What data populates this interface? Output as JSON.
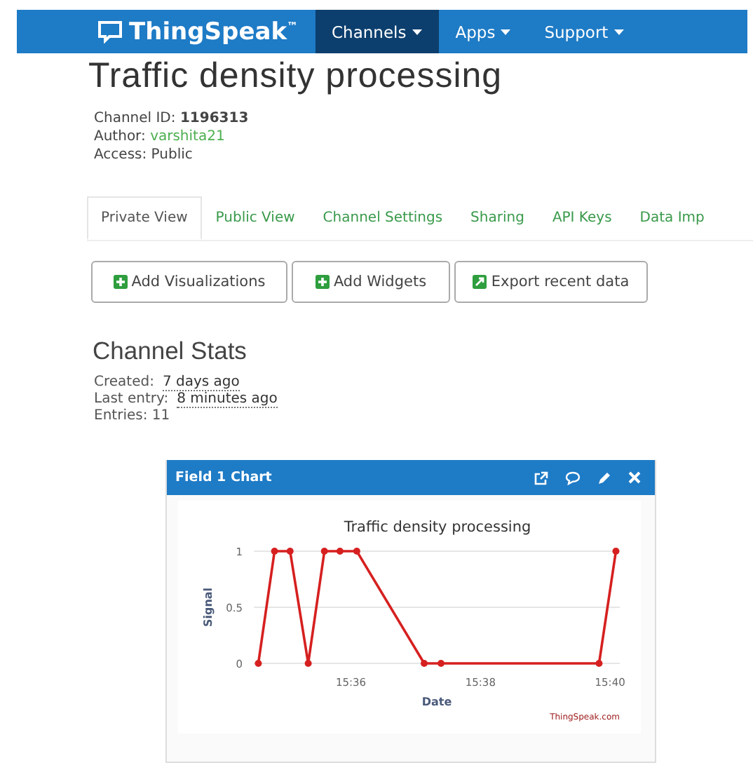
{
  "nav": {
    "logo": "ThingSpeak",
    "trademark": "™",
    "items": [
      {
        "label": "Channels",
        "selected": true
      },
      {
        "label": "Apps",
        "selected": false
      },
      {
        "label": "Support",
        "selected": false
      }
    ]
  },
  "title": "Traffic density processing",
  "info": [
    {
      "label": "Channel ID:",
      "value": "1196313",
      "kind": "bold"
    },
    {
      "label": "Author:",
      "value": "varshita21",
      "kind": "link"
    },
    {
      "label": "Access:",
      "value": "Public",
      "kind": "plain"
    }
  ],
  "tabs": [
    {
      "label": "Private View",
      "selected": true
    },
    {
      "label": "Public View",
      "selected": false
    },
    {
      "label": "Channel Settings",
      "selected": false
    },
    {
      "label": "Sharing",
      "selected": false
    },
    {
      "label": "API Keys",
      "selected": false
    },
    {
      "label": "Data Imp",
      "selected": false
    }
  ],
  "buttons": [
    {
      "label": "Add Visualizations",
      "kind": "add"
    },
    {
      "label": "Add Widgets",
      "kind": "add"
    },
    {
      "label": "Export recent data",
      "kind": "export"
    }
  ],
  "stats": {
    "title": "Channel Stats",
    "rows": [
      {
        "label": "Created:",
        "value": "7 days ago",
        "kind": "time"
      },
      {
        "label": "Last entry:",
        "value": "8 minutes ago",
        "kind": "time"
      },
      {
        "label": "Entries:",
        "value": "11",
        "kind": "plain"
      }
    ]
  },
  "chart_panel": {
    "title": "Field 1 Chart",
    "credit": "ThingSpeak.com",
    "chart_data": {
      "type": "line",
      "title": "Traffic density processing",
      "xlabel": "Date",
      "ylabel": "Signal",
      "x": [
        934.57,
        934.82,
        935.06,
        935.34,
        935.59,
        935.83,
        936.09,
        937.13,
        937.39,
        939.83,
        940.09
      ],
      "series": [
        {
          "color": "#d62020",
          "marker": "circle",
          "values": [
            0,
            1,
            1,
            0,
            1,
            1,
            1,
            0,
            0,
            0,
            1
          ]
        }
      ],
      "xlim": [
        934.5,
        940.15
      ],
      "ylim": [
        0,
        1
      ],
      "xticks": [
        {
          "value": 936,
          "label": "15:36"
        },
        {
          "value": 938,
          "label": "15:38"
        },
        {
          "value": 940,
          "label": "15:40"
        }
      ],
      "yticks": [
        0,
        0.5,
        1
      ]
    }
  }
}
